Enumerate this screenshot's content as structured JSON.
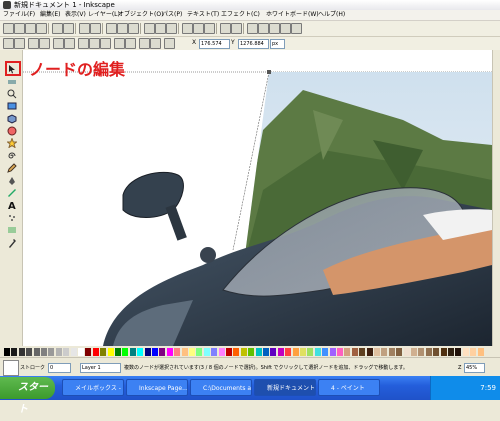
{
  "window": {
    "title": "新規ドキュメント 1 - Inkscape"
  },
  "menu": [
    "ファイル(F)",
    "編集(E)",
    "表示(V)",
    "レイヤー(L)",
    "オブジェクト(O)",
    "パス(P)",
    "テキスト(T)",
    "エフェクト(C)",
    "ホワイトボード(W)",
    "ヘルプ(H)"
  ],
  "controls": {
    "x_label": "X",
    "x_value": "176.574",
    "y_label": "Y",
    "y_value": "1276.884",
    "unit": "px"
  },
  "annotation": {
    "text": "ノードの編集"
  },
  "status": {
    "stroke_label": "ストローク",
    "opacity_value": "0",
    "layer_value": "Layer 1",
    "message": "複数のノードが選択されています(3 / 8 個のノードで選択)。Shift でクリックして選択ノードを追加、ドラッグで移動します。",
    "zoom_label": "Z",
    "zoom_value": "45%"
  },
  "taskbar": {
    "start": "スタート",
    "items": [
      "メイルボックス - Inb...",
      "Inkscape Page...",
      "C:\\Documents an...",
      "新規ドキュメント...",
      "4 - ペイント"
    ],
    "clock": "7:59"
  },
  "colors": {
    "annotation": "#e02020",
    "taskbar": "#245edb",
    "start": "#3c9a2d"
  },
  "palette": [
    "#000000",
    "#1a1a1a",
    "#333333",
    "#4d4d4d",
    "#666666",
    "#808080",
    "#999999",
    "#b3b3b3",
    "#cccccc",
    "#e6e6e6",
    "#ffffff",
    "#800000",
    "#ff0000",
    "#808000",
    "#ffff00",
    "#008000",
    "#00ff00",
    "#008080",
    "#00ffff",
    "#000080",
    "#0000ff",
    "#800080",
    "#ff00ff",
    "#ff8080",
    "#ffc080",
    "#ffff80",
    "#80ff80",
    "#80ffff",
    "#8080ff",
    "#ff80ff",
    "#c00000",
    "#ff6000",
    "#c0c000",
    "#60c000",
    "#00c0c0",
    "#0060c0",
    "#6000c0",
    "#c000c0",
    "#ff4040",
    "#ffa040",
    "#e0e060",
    "#a0e060",
    "#40e0e0",
    "#4090ff",
    "#a060ff",
    "#ff60c0",
    "#d4a080",
    "#a06040",
    "#604020",
    "#402010",
    "#e0c0a0",
    "#c0a080",
    "#a08060",
    "#806040",
    "#f0e0d0",
    "#d0b090",
    "#b09070",
    "#907050",
    "#705030",
    "#503010",
    "#302010",
    "#201008",
    "#ffe0c0",
    "#ffd0a0",
    "#ffc080"
  ]
}
